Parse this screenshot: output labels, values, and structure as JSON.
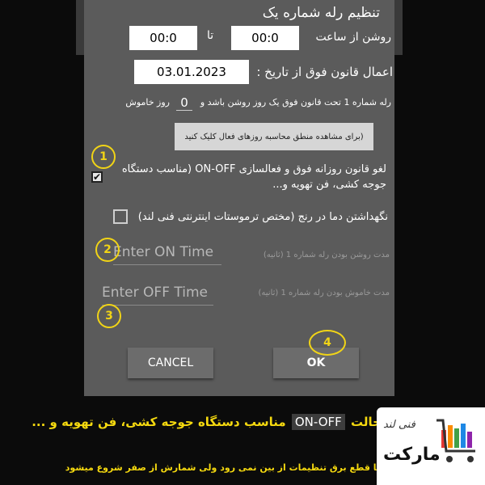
{
  "dialog": {
    "title": "تنظیم رله شماره یک",
    "on_from_label": "روشن از ساعت",
    "from_time": "00:0",
    "to_label": "تا",
    "to_time": "00:0",
    "date_label": "اعمال قانون فوق از تاریخ :",
    "date_value": "03.01.2023",
    "relay_rule_text": "رله شماره 1 تحت قانون فوق یک روز روشن باشد و",
    "off_days": "0",
    "off_days_label": "روز خاموش",
    "note_button": "(برای مشاهده منطق محاسبه روزهای فعال کلیک کنید",
    "cancel_rule_text": "لغو قانون روزانه فوق و فعالسازی ON-OFF (مناسب دستگاه جوجه کشی، فن تهویه و...",
    "keep_temp_text": "نگهداشتن دما در رنج (مختص ترموستات اینترنتی فنی لند)",
    "on_time_placeholder": "Enter ON Time",
    "on_time_hint": "مدت روشن بودن رله شماره 1 (ثانیه)",
    "off_time_placeholder": "Enter OFF Time",
    "off_time_hint": "مدت خاموش بودن رله شماره 1 (ثانیه)",
    "cancel_label": "CANCEL",
    "ok_label": "OK"
  },
  "annotations": [
    "1",
    "2",
    "3",
    "4"
  ],
  "caption": {
    "prefix": "حالت",
    "onoff": "ON-OFF",
    "suffix": "مناسب دستگاه جوجه کشی، فن تهویه و ...",
    "line2": "با قطع برق تنظیمات از بین نمی رود  ولی شمارش از صفر شروع میشود"
  },
  "logo": {
    "line1": "فنی لند",
    "line2": "مارکت"
  },
  "colors": {
    "annotation": "#f1d416",
    "dialog": "#5b5b5b",
    "background": "#0b0b0b"
  }
}
